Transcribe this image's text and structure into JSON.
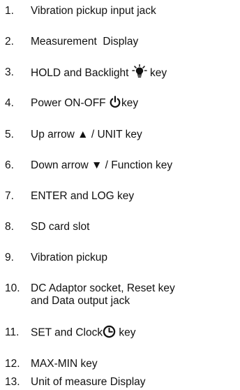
{
  "legend": {
    "items": [
      {
        "number": "1.",
        "text": "Vibration pickup input jack"
      },
      {
        "number": "2.",
        "text": "Measurement  Display"
      },
      {
        "number": "3.",
        "text_before": "HOLD and Backlight ",
        "icon": "backlight-bulb-icon",
        "text_after": " key"
      },
      {
        "number": "4.",
        "text_before": "Power ON-OFF ",
        "icon": "power-icon",
        "text_after": "key"
      },
      {
        "number": "5.",
        "text": "Up arrow ▲ / UNIT key"
      },
      {
        "number": "6.",
        "text": "Down arrow ▼ / Function key"
      },
      {
        "number": "7.",
        "text": "ENTER and LOG key"
      },
      {
        "number": "8.",
        "text": "SD card slot"
      },
      {
        "number": "9.",
        "text": "Vibration pickup"
      },
      {
        "number": "10.",
        "text_line1": "DC Adaptor socket, Reset key",
        "text_line2": "and Data output jack"
      },
      {
        "number": "11.",
        "text_before": "SET and Clock",
        "icon": "clock-icon",
        "text_after": " key"
      },
      {
        "number": "12.",
        "text": "MAX-MIN key"
      },
      {
        "number": "13.",
        "text": "Unit of measure Display"
      }
    ]
  }
}
